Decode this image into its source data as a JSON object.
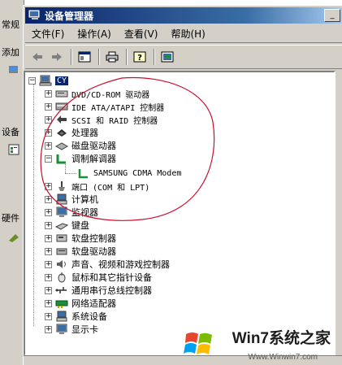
{
  "background": {
    "labels": [
      "常规",
      "添加",
      "设备",
      "硬件"
    ]
  },
  "window": {
    "title": "设备管理器",
    "minimize_glyph": "_"
  },
  "menu": [
    "文件(F)",
    "操作(A)",
    "查看(V)",
    "帮助(H)"
  ],
  "tree": {
    "root": "CY",
    "items": [
      {
        "label": "DVD/CD-ROM 驱动器",
        "icon": "cdrom-icon"
      },
      {
        "label": "IDE ATA/ATAPI 控制器",
        "icon": "ide-icon"
      },
      {
        "label": "SCSI 和 RAID 控制器",
        "icon": "scsi-icon"
      },
      {
        "label": "处理器",
        "icon": "processor-icon"
      },
      {
        "label": "磁盘驱动器",
        "icon": "disk-icon"
      },
      {
        "label": "调制解调器",
        "icon": "modem-icon",
        "expanded": true,
        "children": [
          "SAMSUNG CDMA Modem"
        ]
      },
      {
        "label": "端口 (COM 和 LPT)",
        "icon": "port-icon"
      },
      {
        "label": "计算机",
        "icon": "computer-icon"
      },
      {
        "label": "监视器",
        "icon": "monitor-icon"
      },
      {
        "label": "键盘",
        "icon": "keyboard-icon"
      },
      {
        "label": "软盘控制器",
        "icon": "floppy-controller-icon"
      },
      {
        "label": "软盘驱动器",
        "icon": "floppy-drive-icon"
      },
      {
        "label": "声音、视频和游戏控制器",
        "icon": "sound-icon"
      },
      {
        "label": "鼠标和其它指针设备",
        "icon": "mouse-icon"
      },
      {
        "label": "通用串行总线控制器",
        "icon": "usb-icon"
      },
      {
        "label": "网络适配器",
        "icon": "network-icon"
      },
      {
        "label": "系统设备",
        "icon": "system-icon"
      },
      {
        "label": "显示卡",
        "icon": "display-icon"
      }
    ]
  },
  "watermark": {
    "brand": "Win7系统之家",
    "url": "Www.Winwin7.com"
  },
  "colors": {
    "titlebar": "#0a246a",
    "annotation": "#c8102e"
  }
}
